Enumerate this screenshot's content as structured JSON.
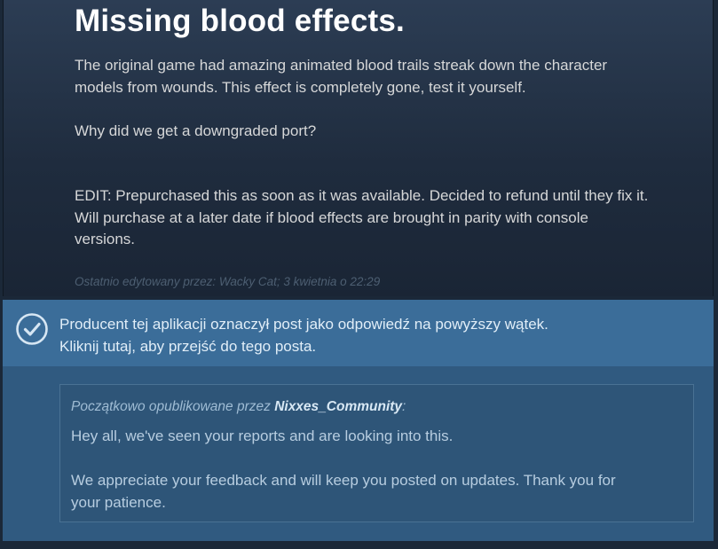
{
  "post": {
    "title": "Missing blood effects.",
    "paragraph_1_line_1": "The original game had amazing animated blood trails streak down the character",
    "paragraph_1_line_2": "models from wounds. This effect is completely gone, test it yourself.",
    "paragraph_2": "Why did we get a downgraded port?",
    "paragraph_3_line_1": "EDIT: Prepurchased this as soon as it was available. Decided to refund until they fix it.",
    "paragraph_3_line_2": "Will purchase at a later date if blood effects are brought in parity with console",
    "paragraph_3_line_3": "versions.",
    "edited_prefix": "Ostatnio edytowany przez:",
    "edited_by": "Wacky Cat",
    "edited_when": "; 3 kwietnia o 22:29"
  },
  "answer_notice": {
    "icon": "checkmark-circle-icon",
    "line_1": "Producent tej aplikacji oznaczył post jako odpowiedź na powyższy wątek.",
    "line_2": "Kliknij tutaj, aby przejść do tego posta."
  },
  "answer_quote": {
    "header_prefix": "Początkowo opublikowane przez ",
    "author": "Nixxes_Community",
    "header_suffix": ":",
    "paragraph_1": "Hey all, we've seen your reports and are looking into this.",
    "paragraph_2_line_1": "We appreciate your feedback and will keep you posted on updates. Thank you for",
    "paragraph_2_line_2": "your patience."
  },
  "colors": {
    "answer_bar": "#3b6d99",
    "answer_panel": "#305a80"
  }
}
